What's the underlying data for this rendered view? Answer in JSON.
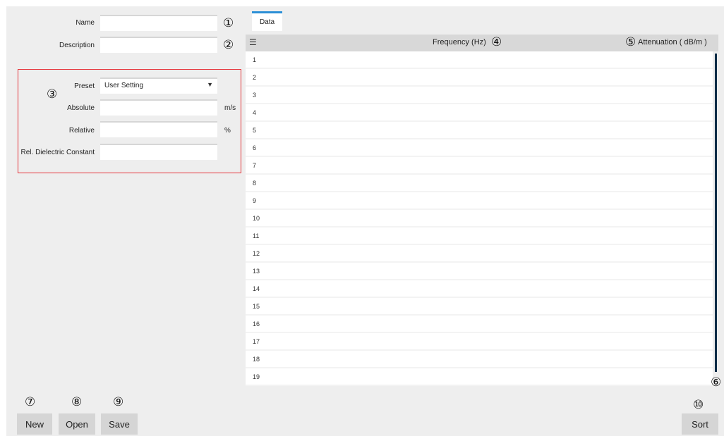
{
  "form": {
    "name_label": "Name",
    "description_label": "Description",
    "preset_label": "Preset",
    "preset_value": "User Setting",
    "absolute_label": "Absolute",
    "absolute_unit": "m/s",
    "relative_label": "Relative",
    "relative_unit": "%",
    "dielectric_label": "Rel. Dielectric Constant",
    "name_value": "",
    "description_value": "",
    "absolute_value": "",
    "relative_value": "",
    "dielectric_value": ""
  },
  "callouts": {
    "c1": "①",
    "c2": "②",
    "c3": "③",
    "c4": "④",
    "c5": "⑤",
    "c6": "⑥",
    "c7": "⑦",
    "c8": "⑧",
    "c9": "⑨",
    "c10": "⑩"
  },
  "buttons": {
    "new": "New",
    "open": "Open",
    "save": "Save",
    "sort": "Sort"
  },
  "tab": {
    "data": "Data"
  },
  "grid": {
    "frequency_header": "Frequency (Hz)",
    "attenuation_header": "Attenuation ( dB/m )",
    "rows": [
      "1",
      "2",
      "3",
      "4",
      "5",
      "6",
      "7",
      "8",
      "9",
      "10",
      "11",
      "12",
      "13",
      "14",
      "15",
      "16",
      "17",
      "18",
      "19"
    ]
  },
  "colors": {
    "highlight": "#e5343a",
    "tab_accent": "#2b8fd6",
    "scrollbar": "#0d2c47"
  }
}
